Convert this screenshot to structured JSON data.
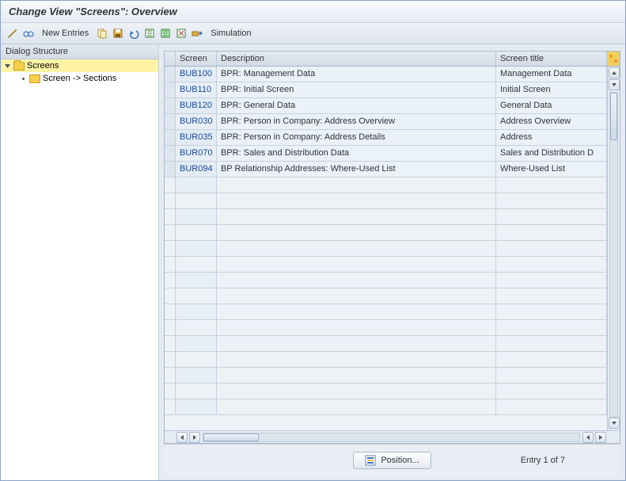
{
  "title": "Change View \"Screens\": Overview",
  "toolbar": {
    "new_entries": "New Entries",
    "simulation": "Simulation"
  },
  "tree": {
    "header": "Dialog Structure",
    "root": {
      "label": "Screens"
    },
    "child": {
      "label": "Screen -> Sections"
    }
  },
  "grid": {
    "columns": {
      "screen": "Screen",
      "description": "Description",
      "title": "Screen title"
    },
    "rows": [
      {
        "screen": "BUB100",
        "description": "BPR: Management Data",
        "title": "Management Data"
      },
      {
        "screen": "BUB110",
        "description": "BPR: Initial Screen",
        "title": "Initial Screen"
      },
      {
        "screen": "BUB120",
        "description": "BPR: General Data",
        "title": "General Data"
      },
      {
        "screen": "BUR030",
        "description": "BPR: Person in Company: Address Overview",
        "title": "Address Overview"
      },
      {
        "screen": "BUR035",
        "description": "BPR: Person in Company: Address Details",
        "title": "Address"
      },
      {
        "screen": "BUR070",
        "description": "BPR: Sales and Distribution Data",
        "title": "Sales and Distribution D"
      },
      {
        "screen": "BUR094",
        "description": "BP Relationship Addresses: Where-Used List",
        "title": "Where-Used List"
      }
    ]
  },
  "footer": {
    "position": "Position...",
    "entry": "Entry 1 of 7"
  }
}
